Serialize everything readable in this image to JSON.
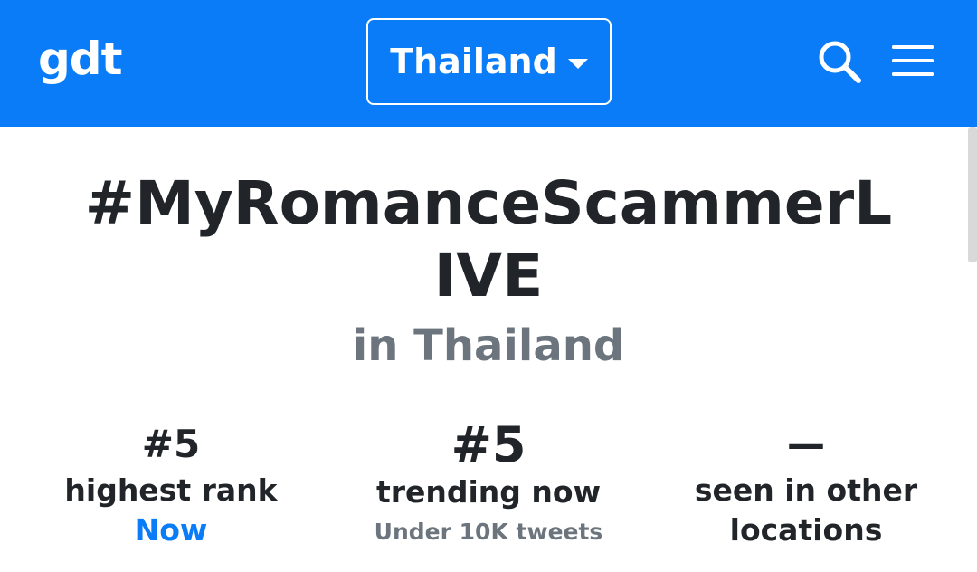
{
  "header": {
    "logo": "gdt",
    "country": "Thailand",
    "icons": {
      "search": "search-icon",
      "menu": "hamburger-menu-icon",
      "dropdown": "caret-down-icon"
    },
    "colors": {
      "background": "#0a7cf7",
      "foreground": "#ffffff"
    }
  },
  "main": {
    "hashtag": "#MyRomanceScammerLIVE",
    "location": "in Thailand"
  },
  "stats": {
    "highest_rank": {
      "value": "#5",
      "label": "highest rank",
      "when": "Now"
    },
    "trending_now": {
      "value": "#5",
      "label": "trending now",
      "tweets": "Under 10K tweets"
    },
    "other_locations": {
      "value": "—",
      "label": "seen in other locations"
    }
  },
  "colors": {
    "accent": "#0a7cf7",
    "text": "#212529",
    "muted": "#6c757d"
  }
}
